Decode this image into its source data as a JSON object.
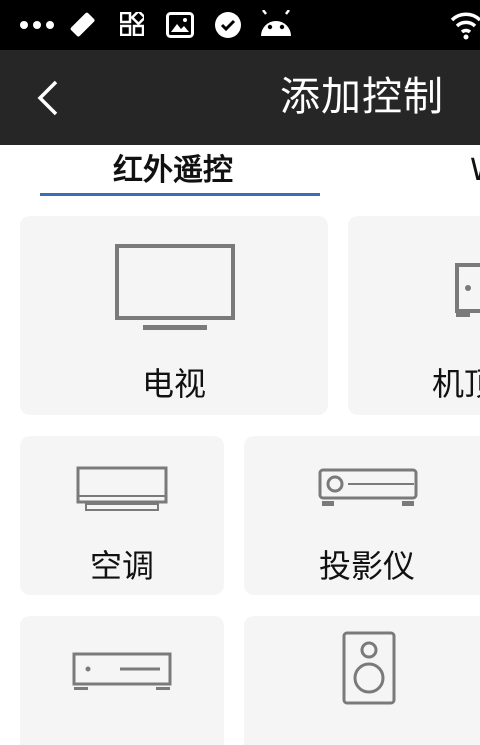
{
  "header": {
    "title": "添加控制"
  },
  "tabs": [
    {
      "label": "红外遥控",
      "active": true
    },
    {
      "label": "W",
      "active": false
    }
  ],
  "devices": [
    {
      "label": "电视",
      "icon": "tv-icon"
    },
    {
      "label": "机顶",
      "icon": "set-top-box-icon"
    },
    {
      "label": "空调",
      "icon": "air-conditioner-icon"
    },
    {
      "label": "投影仪",
      "icon": "projector-icon"
    },
    {
      "label": "",
      "icon": "media-box-icon"
    },
    {
      "label": "",
      "icon": "speaker-icon"
    }
  ],
  "colors": {
    "statusbar": "#000000",
    "appbar": "#262626",
    "tab_indicator": "#3a6fb5",
    "card_bg": "#f5f5f5",
    "icon": "#7a7a7a"
  }
}
